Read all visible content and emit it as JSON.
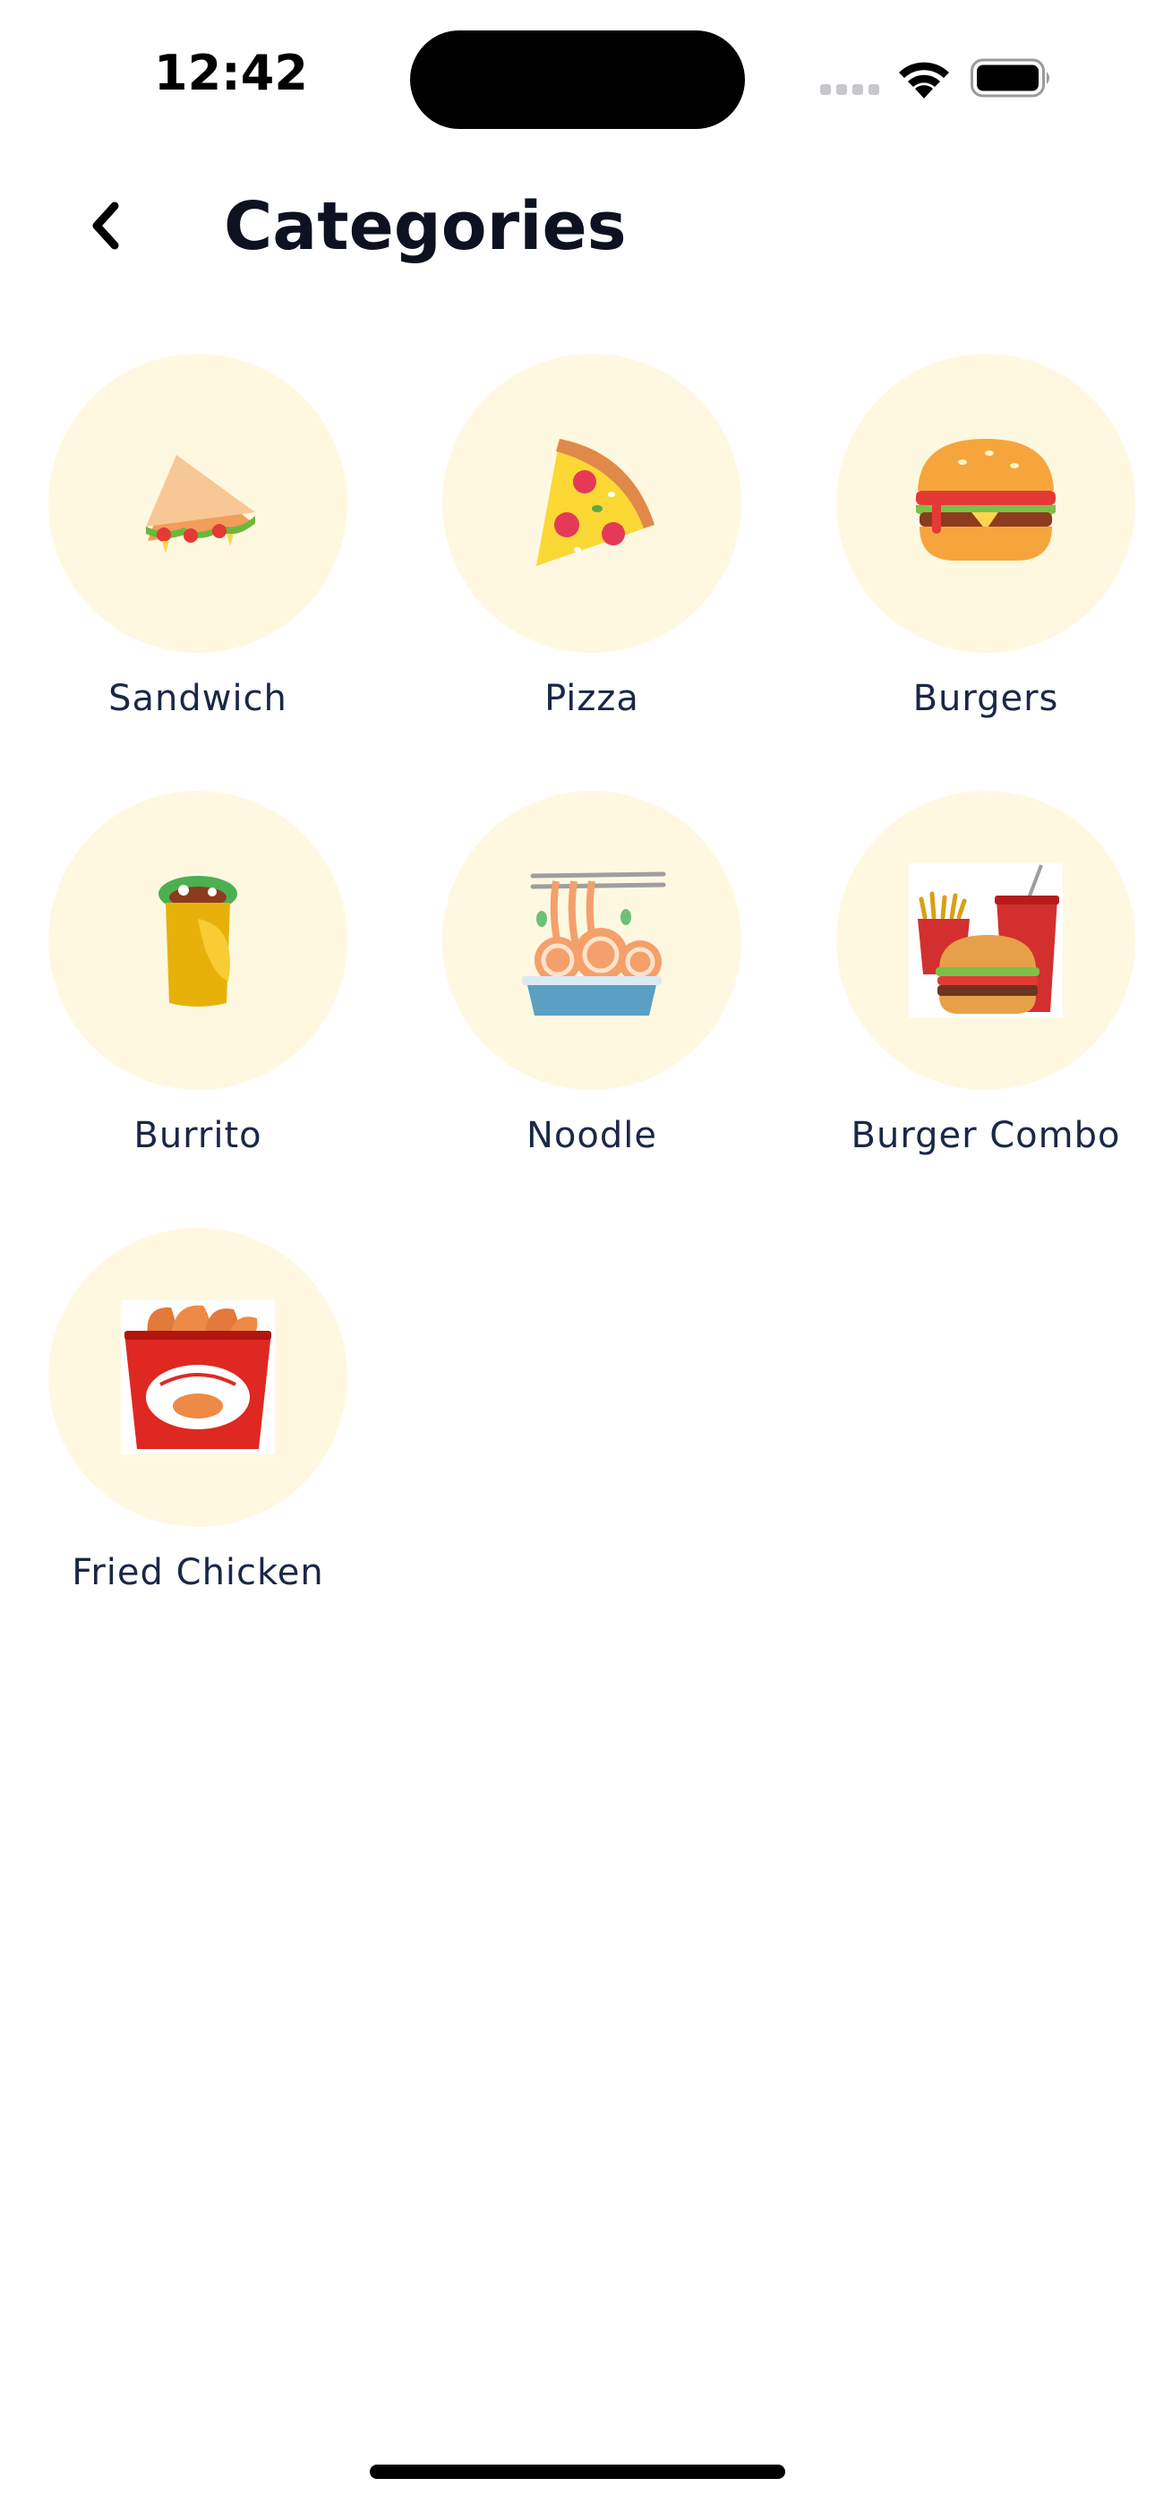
{
  "status_bar": {
    "time": "12:42"
  },
  "header": {
    "back_icon": "chevron-left-icon",
    "title": "Categories"
  },
  "theme": {
    "circle_bg": "#fff8e1",
    "label_color": "#1b2747",
    "title_color": "#0d1120"
  },
  "categories": [
    {
      "label": "Sandwich",
      "icon": "sandwich-icon"
    },
    {
      "label": "Pizza",
      "icon": "pizza-icon"
    },
    {
      "label": "Burgers",
      "icon": "burger-icon"
    },
    {
      "label": "Burrito",
      "icon": "burrito-icon"
    },
    {
      "label": "Noodle",
      "icon": "noodle-icon"
    },
    {
      "label": "Burger Combo",
      "icon": "burger-combo-icon"
    },
    {
      "label": "Fried Chicken",
      "icon": "fried-chicken-icon"
    }
  ]
}
